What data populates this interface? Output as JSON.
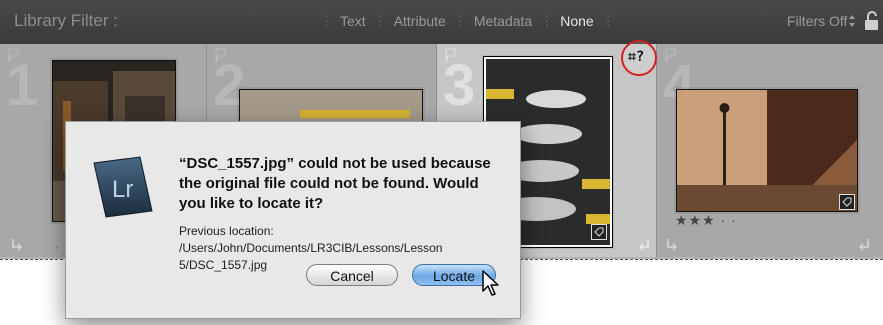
{
  "filter_bar": {
    "title": "Library Filter :",
    "tabs": [
      "Text",
      "Attribute",
      "Metadata",
      "None"
    ],
    "active_tab": "None",
    "filters_status": "Filters Off"
  },
  "grid": {
    "cells": [
      {
        "number": "1"
      },
      {
        "number": "2"
      },
      {
        "number": "3",
        "selected": true,
        "badge": "missing-file"
      },
      {
        "number": "4",
        "rating": "★★★ · ·"
      }
    ]
  },
  "dialog": {
    "message": "“DSC_1557.jpg” could not be used because the original file could not be found. Would you like to locate it?",
    "location_text": "Previous location: /Users/John/Documents/LR3CIB/Lessons/Lesson 5/DSC_1557.jpg",
    "app_icon_label": "Lr",
    "cancel_label": "Cancel",
    "locate_label": "Locate"
  },
  "colors": {
    "highlight_ring": "#d42020",
    "default_button": "#6ea8e4"
  }
}
